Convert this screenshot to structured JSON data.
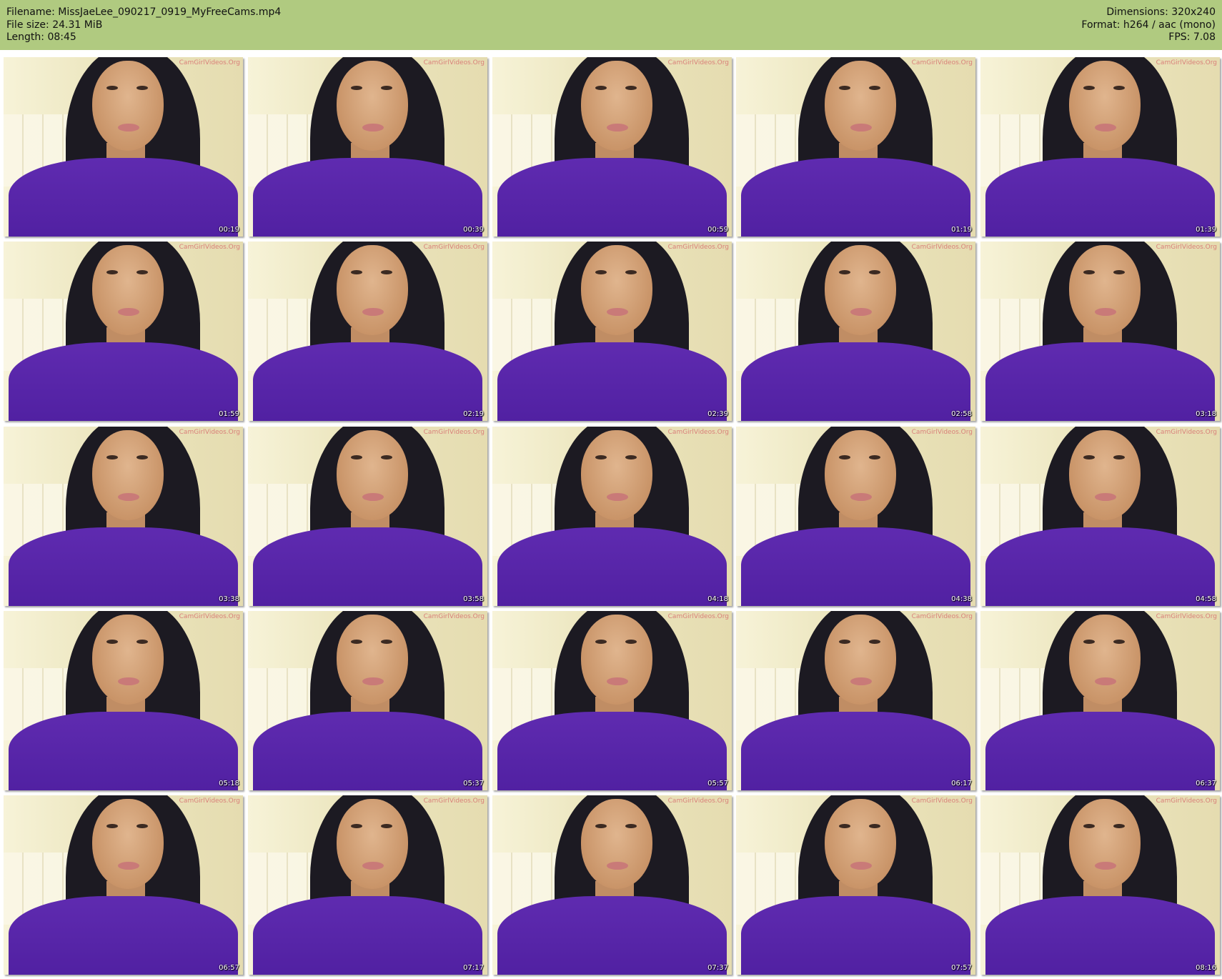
{
  "header": {
    "left": [
      "Filename: MissJaeLee_090217_0919_MyFreeCams.mp4",
      "File size: 24.31 MiB",
      "Length: 08:45"
    ],
    "right": [
      "Dimensions: 320x240",
      "Format: h264 / aac (mono)",
      "FPS: 7.08"
    ],
    "background_color": "#b0ca80"
  },
  "thumbnails": {
    "watermark": "CamGirlVideos.Org",
    "timestamps": [
      "00:19",
      "00:39",
      "00:59",
      "01:19",
      "01:39",
      "01:59",
      "02:19",
      "02:39",
      "02:58",
      "03:18",
      "03:38",
      "03:58",
      "04:18",
      "04:38",
      "04:58",
      "05:18",
      "05:37",
      "05:57",
      "06:17",
      "06:37",
      "06:57",
      "07:17",
      "07:37",
      "07:57",
      "08:16"
    ]
  }
}
